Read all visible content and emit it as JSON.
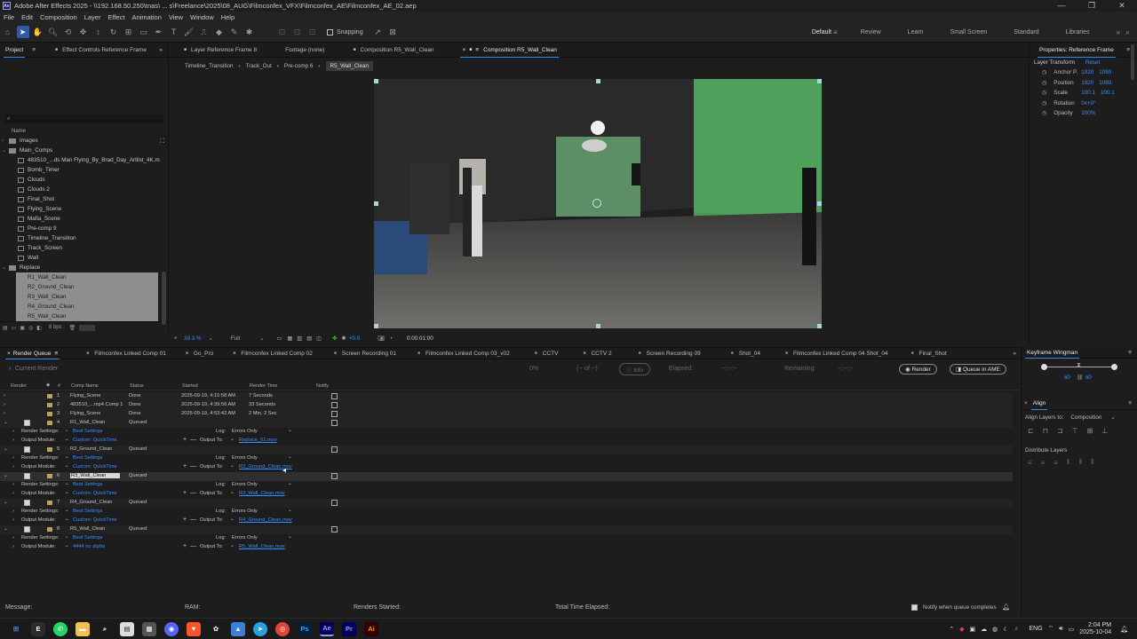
{
  "titlebar": {
    "app_icon": "Ae",
    "title": "Adobe After Effects 2025 - \\\\192.168.50.250\\tnas\\ ... s\\Freelance\\2025\\08_AUG\\Filmconfex_VFX\\Filmconfex_AE\\Filmconfex_AE_02.aep"
  },
  "menu": [
    "File",
    "Edit",
    "Composition",
    "Layer",
    "Effect",
    "Animation",
    "View",
    "Window",
    "Help"
  ],
  "toolbar": {
    "snapping": "Snapping",
    "workspaces": [
      "Default",
      "Review",
      "Learn",
      "Small Screen",
      "Standard",
      "Libraries"
    ]
  },
  "project": {
    "tabs": {
      "project": "Project",
      "effect_controls": "Effect Controls Reference Frame"
    },
    "search_placeholder": "",
    "name_col": "Name",
    "items": [
      {
        "label": "Images",
        "type": "folder"
      },
      {
        "label": "Main_Comps",
        "type": "folder"
      },
      {
        "label": "483510_...ds Man Flying_By_Brad_Day_Artlist_4K.m",
        "type": "comp"
      },
      {
        "label": "Bomb_Timer",
        "type": "comp"
      },
      {
        "label": "Clouds",
        "type": "comp"
      },
      {
        "label": "Clouds 2",
        "type": "comp"
      },
      {
        "label": "Final_Shot",
        "type": "comp"
      },
      {
        "label": "Flying_Scene",
        "type": "comp"
      },
      {
        "label": "Mafia_Scene",
        "type": "comp"
      },
      {
        "label": "Pre-comp 9",
        "type": "comp"
      },
      {
        "label": "Timeline_Transition",
        "type": "comp"
      },
      {
        "label": "Track_Screen",
        "type": "comp"
      },
      {
        "label": "Wall",
        "type": "comp"
      },
      {
        "label": "Replace",
        "type": "folder"
      },
      {
        "label": "R1_Wall_Clean",
        "type": "comp"
      },
      {
        "label": "R2_Ground_Clean",
        "type": "comp"
      },
      {
        "label": "R3_Wall_Clean",
        "type": "comp"
      },
      {
        "label": "R4_Ground_Clean",
        "type": "comp"
      },
      {
        "label": "R5_Wall_Clean",
        "type": "comp"
      }
    ],
    "bpc": "8 bpc"
  },
  "viewer": {
    "tabs": {
      "layer": "Layer Reference Frame 8",
      "footage": "Footage (none)",
      "comp1": "Composition R5_Wall_Clean",
      "comp2": "Composition R5_Wall_Clean"
    },
    "breadcrumbs": [
      "Timeline_Transition",
      "Track_Out",
      "Pre-comp 6",
      "R5_Wall_Clean"
    ],
    "zoom": "39.3 %",
    "resolution": "Full",
    "exposure": "+0.0",
    "timecode": "0:00:01:00"
  },
  "properties": {
    "title": "Properties: Reference Frame",
    "section": "Layer Transform",
    "reset": "Reset",
    "rows": [
      {
        "label": "Anchor P.",
        "v1": "1920",
        "v2": "1080"
      },
      {
        "label": "Position",
        "v1": "1920",
        "v2": "1080"
      },
      {
        "label": "Scale",
        "v1": "100.1",
        "v2": "100.1"
      },
      {
        "label": "Rotation",
        "v1": "0x+0°",
        "v2": ""
      },
      {
        "label": "Opacity",
        "v1": "100%",
        "v2": ""
      }
    ]
  },
  "render_queue": {
    "tabs": [
      "Render Queue",
      "Filmconfex Linked Comp 01",
      "Go_Pro",
      "Filmconfex Linked Comp 02",
      "Screen Recording 01",
      "Filmconfex Linked Comp 03_v02",
      "CCTV",
      "CCTV 2",
      "Screen Recording 09",
      "Shot_04",
      "Filmconfex Linked Comp 04 Shot_04",
      "Final_Shot"
    ],
    "current_render": "Current Render",
    "percent": "0%",
    "of": "(-- of --)",
    "info": "Info",
    "elapsed_label": "Elapsed:",
    "elapsed": "--:--:--",
    "remaining_label": "Remaining:",
    "remaining": "--:--:--",
    "render_btn": "Render",
    "ame_btn": "Queue in AME",
    "headers": {
      "render": "Render",
      "num": "#",
      "comp": "Comp Name",
      "status": "Status",
      "started": "Started",
      "time": "Render Time",
      "notify": "Notify"
    },
    "done_rows": [
      {
        "num": "1",
        "comp": "Flying_Scene",
        "status": "Done",
        "started": "2025-09-19, 4:15:58 AM",
        "time": "7 Seconds"
      },
      {
        "num": "2",
        "comp": "483510_...mp4 Comp 1",
        "status": "Done",
        "started": "2025-09-19, 4:39:58 AM",
        "time": "33 Seconds"
      },
      {
        "num": "3",
        "comp": "Flying_Scene",
        "status": "Done",
        "started": "2025-09-19, 4:53:42 AM",
        "time": "2 Min, 2 Sec"
      }
    ],
    "queued": [
      {
        "num": "4",
        "comp": "R1_Wall_Clean",
        "status": "Queued",
        "settings": "Best Settings",
        "module": "Custom: QuickTime",
        "log": "Errors Only",
        "output": "Replace_01.mov"
      },
      {
        "num": "5",
        "comp": "R2_Ground_Clean",
        "status": "Queued",
        "settings": "Best Settings",
        "module": "Custom: QuickTime",
        "log": "Errors Only",
        "output": "R2_Ground_Clean.mov"
      },
      {
        "num": "6",
        "comp": "R3_Wall_Clean",
        "status": "Queued",
        "settings": "Best Settings",
        "module": "Custom: QuickTime",
        "log": "Errors Only",
        "output": "R3_Wall_Clean.mov"
      },
      {
        "num": "7",
        "comp": "R4_Ground_Clean",
        "status": "Queued",
        "settings": "Best Settings",
        "module": "Custom: QuickTime",
        "log": "Errors Only",
        "output": "R4_Ground_Clean.mov"
      },
      {
        "num": "8",
        "comp": "R5_Wall_Clean",
        "status": "Queued",
        "settings": "Best Settings",
        "module": "4444 no alpha",
        "log": "Errors Only",
        "output": "R5_Wall_Clean.mov"
      }
    ],
    "labels": {
      "render_settings": "Render Settings:",
      "output_module": "Output Module:",
      "log": "Log:",
      "output_to": "Output To:"
    },
    "footer": {
      "message": "Message:",
      "ram": "RAM:",
      "renders_started": "Renders Started:",
      "total": "Total Time Elapsed:",
      "notify": "Notify when queue completes"
    }
  },
  "keyframe": {
    "title": "Keyframe Wingman",
    "v1": "60",
    "v2": "60"
  },
  "align": {
    "title": "Align",
    "align_to_label": "Align Layers to:",
    "align_to": "Composition",
    "distribute": "Distribute Layers"
  },
  "taskbar": {
    "lang": "ENG",
    "time": "2:04 PM",
    "date": "2025-10-04"
  }
}
